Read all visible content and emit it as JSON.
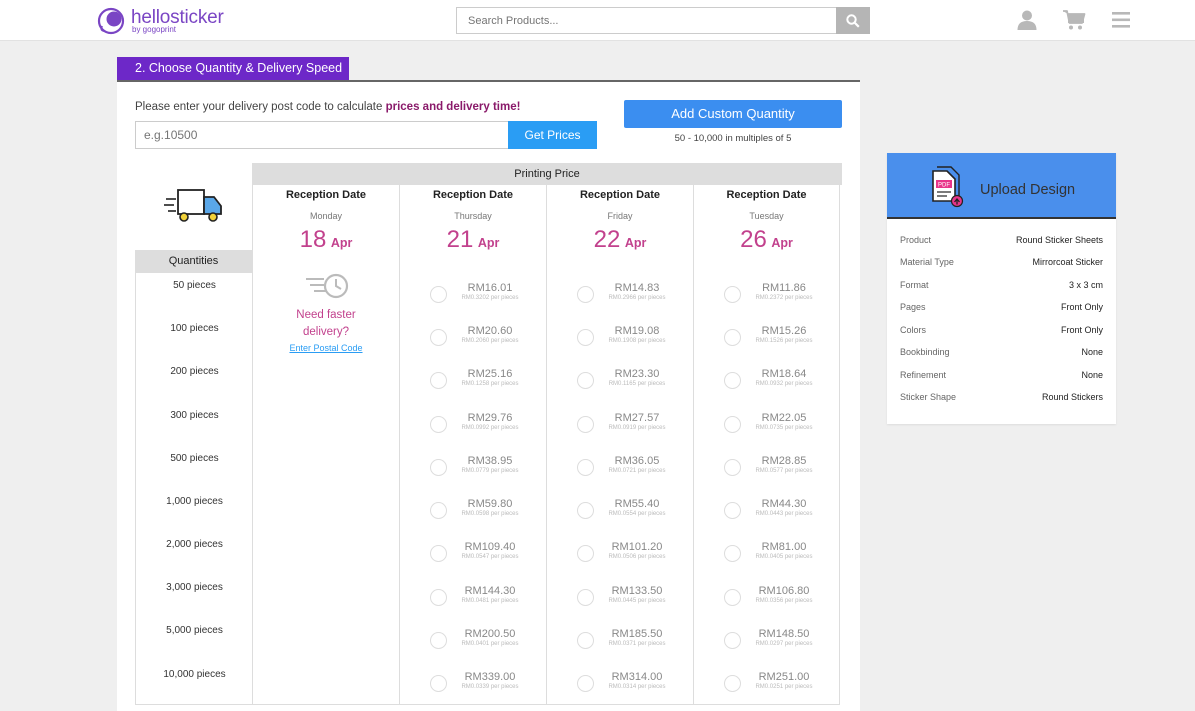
{
  "header": {
    "logo_text": "hellosticker",
    "logo_sub": "by gogoprint",
    "search_placeholder": "Search Products...",
    "icons": [
      "search-icon",
      "user-icon",
      "cart-icon",
      "menu-icon"
    ]
  },
  "step": {
    "title": "2. Choose Quantity & Delivery Speed"
  },
  "postal": {
    "label_prefix": "Please enter your delivery post code to calculate ",
    "label_bold": "prices and delivery time!",
    "placeholder": "e.g.10500",
    "button": "Get Prices"
  },
  "custom": {
    "button": "Add Custom Quantity",
    "note": "50 - 10,000 in multiples of 5"
  },
  "quantities_header": "Quantities",
  "quantities": [
    "50 pieces",
    "100 pieces",
    "200 pieces",
    "300 pieces",
    "500 pieces",
    "1,000 pieces",
    "2,000 pieces",
    "3,000 pieces",
    "5,000 pieces",
    "10,000 pieces"
  ],
  "printing_price_header": "Printing Price",
  "date_columns": [
    {
      "title": "Reception Date",
      "day": "Monday",
      "date": "18",
      "month": "Apr",
      "faster_text_1": "Need faster",
      "faster_text_2": "delivery?",
      "faster_link": "Enter Postal Code",
      "prices": []
    },
    {
      "title": "Reception Date",
      "day": "Thursday",
      "date": "21",
      "month": "Apr",
      "prices": [
        {
          "price": "RM16.01",
          "unit": "RM0.3202 per pieces"
        },
        {
          "price": "RM20.60",
          "unit": "RM0.2060 per pieces"
        },
        {
          "price": "RM25.16",
          "unit": "RM0.1258 per pieces"
        },
        {
          "price": "RM29.76",
          "unit": "RM0.0992 per pieces"
        },
        {
          "price": "RM38.95",
          "unit": "RM0.0779 per pieces"
        },
        {
          "price": "RM59.80",
          "unit": "RM0.0598 per pieces"
        },
        {
          "price": "RM109.40",
          "unit": "RM0.0547 per pieces"
        },
        {
          "price": "RM144.30",
          "unit": "RM0.0481 per pieces"
        },
        {
          "price": "RM200.50",
          "unit": "RM0.0401 per pieces"
        },
        {
          "price": "RM339.00",
          "unit": "RM0.0339 per pieces"
        }
      ]
    },
    {
      "title": "Reception Date",
      "day": "Friday",
      "date": "22",
      "month": "Apr",
      "prices": [
        {
          "price": "RM14.83",
          "unit": "RM0.2966 per pieces"
        },
        {
          "price": "RM19.08",
          "unit": "RM0.1908 per pieces"
        },
        {
          "price": "RM23.30",
          "unit": "RM0.1165 per pieces"
        },
        {
          "price": "RM27.57",
          "unit": "RM0.0919 per pieces"
        },
        {
          "price": "RM36.05",
          "unit": "RM0.0721 per pieces"
        },
        {
          "price": "RM55.40",
          "unit": "RM0.0554 per pieces"
        },
        {
          "price": "RM101.20",
          "unit": "RM0.0506 per pieces"
        },
        {
          "price": "RM133.50",
          "unit": "RM0.0445 per pieces"
        },
        {
          "price": "RM185.50",
          "unit": "RM0.0371 per pieces"
        },
        {
          "price": "RM314.00",
          "unit": "RM0.0314 per pieces"
        }
      ]
    },
    {
      "title": "Reception Date",
      "day": "Tuesday",
      "date": "26",
      "month": "Apr",
      "prices": [
        {
          "price": "RM11.86",
          "unit": "RM0.2372 per pieces"
        },
        {
          "price": "RM15.26",
          "unit": "RM0.1526 per pieces"
        },
        {
          "price": "RM18.64",
          "unit": "RM0.0932 per pieces"
        },
        {
          "price": "RM22.05",
          "unit": "RM0.0735 per pieces"
        },
        {
          "price": "RM28.85",
          "unit": "RM0.0577 per pieces"
        },
        {
          "price": "RM44.30",
          "unit": "RM0.0443 per pieces"
        },
        {
          "price": "RM81.00",
          "unit": "RM0.0405 per pieces"
        },
        {
          "price": "RM106.80",
          "unit": "RM0.0356 per pieces"
        },
        {
          "price": "RM148.50",
          "unit": "RM0.0297 per pieces"
        },
        {
          "price": "RM251.00",
          "unit": "RM0.0251 per pieces"
        }
      ]
    }
  ],
  "upload": {
    "label": "Upload Design",
    "file_badge": "PDF",
    "specs": [
      {
        "key": "Product",
        "value": "Round Sticker Sheets"
      },
      {
        "key": "Material Type",
        "value": "Mirrorcoat Sticker"
      },
      {
        "key": "Format",
        "value": "3 x 3 cm"
      },
      {
        "key": "Pages",
        "value": "Front Only"
      },
      {
        "key": "Colors",
        "value": "Front Only"
      },
      {
        "key": "Bookbinding",
        "value": "None"
      },
      {
        "key": "Refinement",
        "value": "None"
      },
      {
        "key": "Sticker Shape",
        "value": "Round Stickers"
      }
    ]
  },
  "colors": {
    "brand": "#7a45c4",
    "step_tab": "#6d28c8",
    "accent_blue": "#3b8ef0",
    "date_pink": "#c2418d"
  }
}
